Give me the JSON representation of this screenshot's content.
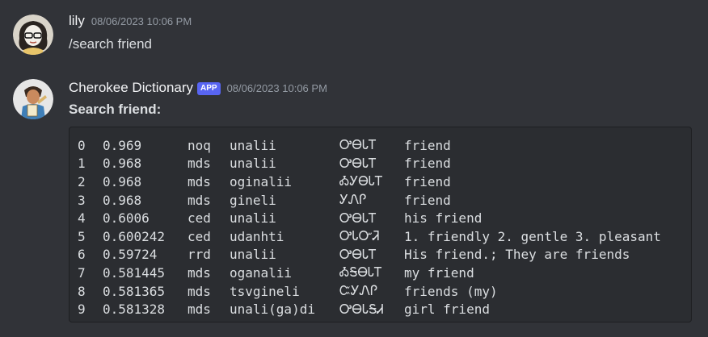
{
  "messages": [
    {
      "username": "lily",
      "timestamp": "08/06/2023 10:06 PM",
      "text": "/search friend"
    },
    {
      "username": "Cherokee Dictionary",
      "badge": "APP",
      "timestamp": "08/06/2023 10:06 PM",
      "heading": "Search friend:"
    }
  ],
  "results": [
    {
      "idx": "0",
      "score": "0.969",
      "source": "noq",
      "latin": "unalii",
      "syllabary": "ᎤᎾᏓᎢ",
      "definition": "friend"
    },
    {
      "idx": "1",
      "score": "0.968",
      "source": "mds",
      "latin": "unalii",
      "syllabary": "ᎤᎾᏓᎢ",
      "definition": "friend"
    },
    {
      "idx": "2",
      "score": "0.968",
      "source": "mds",
      "latin": "oginalii",
      "syllabary": "ᎣᎩᎾᏓᎢ",
      "definition": "friend"
    },
    {
      "idx": "3",
      "score": "0.968",
      "source": "mds",
      "latin": "gineli",
      "syllabary": "ᎩᏁᎵ",
      "definition": "friend"
    },
    {
      "idx": "4",
      "score": "0.6006",
      "source": "ced",
      "latin": "unalii",
      "syllabary": "ᎤᎾᏓᎢ",
      "definition": "his friend"
    },
    {
      "idx": "5",
      "score": "0.600242",
      "source": "ced",
      "latin": "udanhti",
      "syllabary": "ᎤᏓᏅᏘ",
      "definition": "1. friendly 2. gentle 3. pleasant"
    },
    {
      "idx": "6",
      "score": "0.59724",
      "source": "rrd",
      "latin": "unalii",
      "syllabary": "ᎤᎾᏓᎢ",
      "definition": "His friend.; They are friends"
    },
    {
      "idx": "7",
      "score": "0.581445",
      "source": "mds",
      "latin": "oganalii",
      "syllabary": "ᎣᎦᎾᏓᎢ",
      "definition": "my friend"
    },
    {
      "idx": "8",
      "score": "0.581365",
      "source": "mds",
      "latin": "tsvgineli",
      "syllabary": "ᏨᎩᏁᎵ",
      "definition": "friends (my)"
    },
    {
      "idx": "9",
      "score": "0.581328",
      "source": "mds",
      "latin": "unali(ga)di",
      "syllabary": "ᎤᎾᏓᎦᏗ",
      "definition": "girl friend"
    }
  ],
  "colors": {
    "background": "#313338",
    "codeblock": "#2b2d31",
    "username": "#f2f3f5",
    "timestamp": "#949ba4",
    "badge": "#5865f2",
    "text": "#dbdee1"
  }
}
